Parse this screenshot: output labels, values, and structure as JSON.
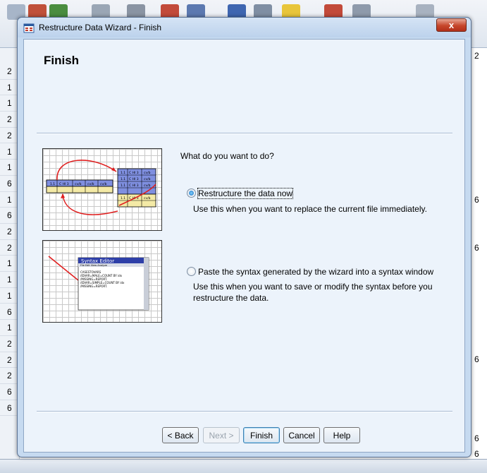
{
  "window": {
    "title": "Restructure Data Wizard - Finish",
    "close_glyph": "x"
  },
  "page": {
    "heading": "Finish",
    "question": "What do you want to do?"
  },
  "options": [
    {
      "label": "Restructure the data now",
      "description": "Use this when you want to replace the current file immediately.",
      "selected": true
    },
    {
      "label": "Paste the syntax generated by the wizard into a syntax window",
      "description": "Use this when you want to save or modify the syntax before you restructure the data.",
      "selected": false
    }
  ],
  "illustration_syntax": {
    "title": "Syntax Editor",
    "menu": "File  Edit  View  Analyze",
    "lines": [
      "CASESTOVARS",
      "/IDVAR=MALE=COUNT BY idx",
      "/MISSING=REPORT.",
      "/IDVAR=SIMPLE=COUNT BY idx",
      "/MISSING=REPORT."
    ]
  },
  "illustration_restructure": {
    "wide_row": [
      "1.1",
      "C HI 3",
      "cv/b",
      "cv/b",
      "cv/b"
    ],
    "long_rows": [
      [
        "1.1",
        "C HI 3",
        "cv/b"
      ],
      [
        "1.1",
        "C HI 3",
        "cv/b"
      ],
      [
        "1.1",
        "C HI 3",
        "cv/b"
      ],
      [
        "1.1",
        "C HI 3",
        "cv/b"
      ]
    ]
  },
  "buttons": {
    "back": "< Back",
    "next": "Next >",
    "finish": "Finish",
    "cancel": "Cancel",
    "help": "Help"
  },
  "background": {
    "row_numbers": [
      "2",
      "1",
      "1",
      "2",
      "2",
      "1",
      "1",
      "6",
      "1",
      "6",
      "2",
      "2",
      "1",
      "1",
      "1",
      "6",
      "1",
      "2",
      "2",
      "2",
      "6",
      "6"
    ],
    "right_col_header": "2",
    "right_values": [
      "6",
      "6",
      "6",
      "6",
      "6"
    ]
  },
  "colors": {
    "dialog_frame": "#c6daf0",
    "client": "#ecf3fb",
    "close_button": "#c6462b"
  }
}
